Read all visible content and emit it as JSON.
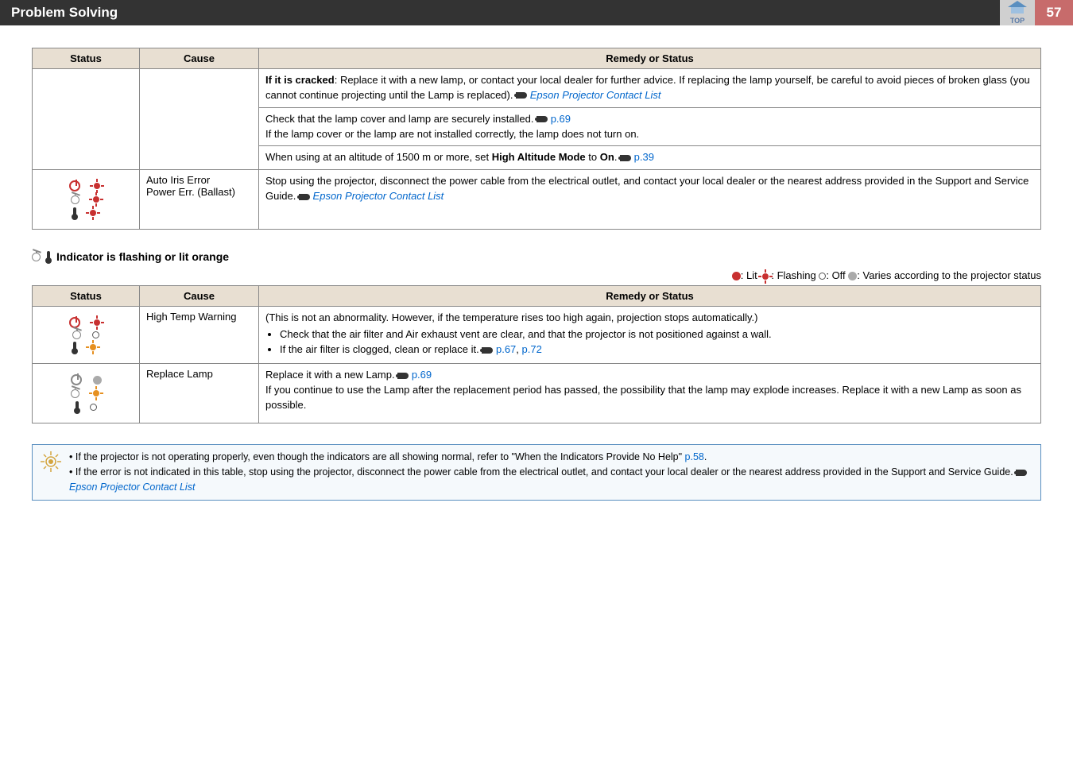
{
  "header": {
    "title": "Problem Solving",
    "top_label": "TOP",
    "page_number": "57"
  },
  "table1": {
    "headers": {
      "status": "Status",
      "cause": "Cause",
      "remedy": "Remedy or Status"
    },
    "r1_text": "If it is cracked: Replace it with a new lamp, or contact your local dealer for further advice. If replacing the lamp yourself, be careful to avoid pieces of broken glass (you cannot continue projecting until the Lamp is replaced). ",
    "r1_link": "Epson Projector Contact List",
    "r1b_pre": "Check that the lamp cover and lamp are securely installed. ",
    "r1b_link": "p.69",
    "r1b_post": "If the lamp cover or the lamp are not installed correctly, the lamp does not turn on.",
    "r1c_pre": "When using at an altitude of 1500 m or more, set ",
    "r1c_bold1": "High Altitude Mode",
    "r1c_mid": " to ",
    "r1c_bold2": "On",
    "r1c_end": ". ",
    "r1c_link": "p.39",
    "r2_cause1": "Auto Iris Error",
    "r2_cause2": "Power Err. (Ballast)",
    "r2_text": "Stop using the projector, disconnect the power cable from the electrical outlet, and contact your local dealer or the nearest address provided in the Support and Service Guide. ",
    "r2_link": "Epson Projector Contact List"
  },
  "section2": {
    "heading": "Indicator is flashing or lit orange"
  },
  "legend": {
    "lit": ": Lit ",
    "flashing": ": Flashing  ",
    "off": ": Off  ",
    "varies": ": Varies according to the projector status"
  },
  "table2": {
    "headers": {
      "status": "Status",
      "cause": "Cause",
      "remedy": "Remedy or Status"
    },
    "r1_cause": "High Temp Warning",
    "r1_a": "(This is not an abnormality. However, if the temperature rises too high again, projection stops automatically.)",
    "r1_b1": "Check that the air filter and Air exhaust vent are clear, and that the projector is not positioned against a wall.",
    "r1_b2_pre": "If the air filter is clogged, clean or replace it. ",
    "r1_b2_link1": "p.67",
    "r1_b2_sep": ", ",
    "r1_b2_link2": "p.72",
    "r2_cause": "Replace Lamp",
    "r2_a_pre": "Replace it with a new Lamp. ",
    "r2_a_link": "p.69",
    "r2_b": "If you continue to use the Lamp after the replacement period has passed, the possibility that the lamp may explode increases. Replace it with a new Lamp as soon as possible."
  },
  "tip": {
    "b1_pre": "If the projector is not operating properly, even though the indicators are all showing normal, refer to \"When the Indicators Provide No Help\" ",
    "b1_link": "p.58",
    "b1_end": ".",
    "b2_pre": "If the error is not indicated in this table, stop using the projector, disconnect the power cable from the electrical outlet, and contact your local dealer or the nearest address provided in the Support and Service Guide. ",
    "b2_link": "Epson Projector Contact List"
  }
}
